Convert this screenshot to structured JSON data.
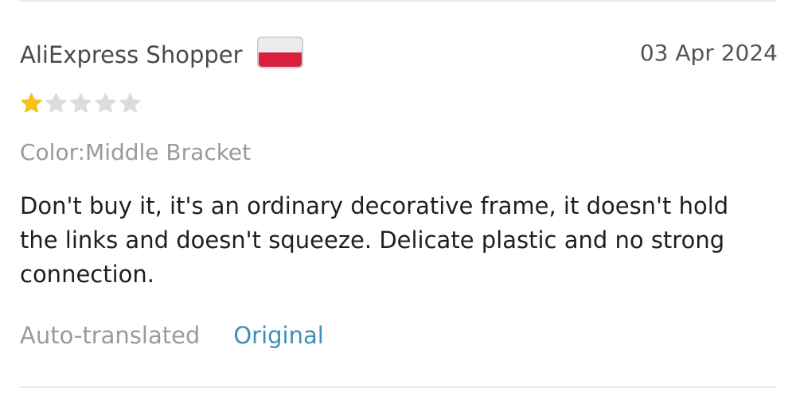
{
  "review": {
    "author": "AliExpress Shopper",
    "country_flag": "poland-flag-icon",
    "date": "03 Apr 2024",
    "rating": 1,
    "rating_max": 5,
    "star_color_filled": "#f6c21c",
    "star_color_empty": "#dcdcdc",
    "variant": "Color:Middle Bracket",
    "text": "Don't buy it, it's an ordinary decorative frame, it doesn't hold the links and doesn't squeeze. Delicate plastic and no strong connection.",
    "auto_translated_label": "Auto-translated",
    "original_link_label": "Original",
    "link_color": "#3c8fb5"
  }
}
